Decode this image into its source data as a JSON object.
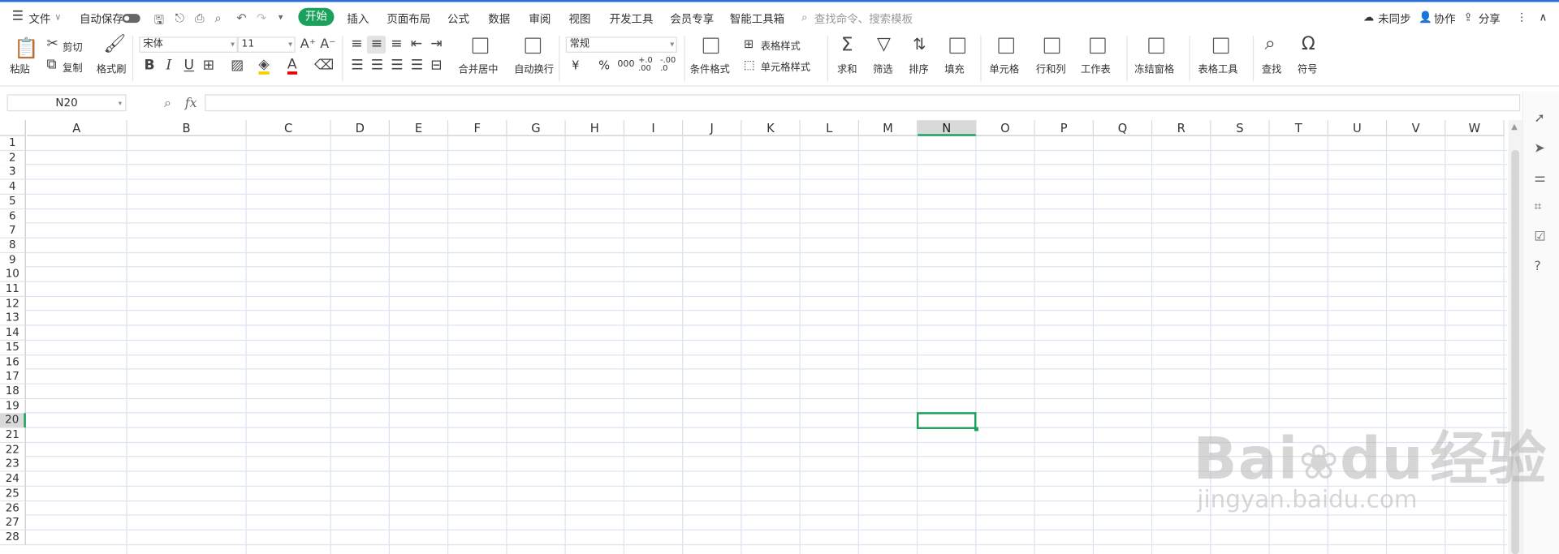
{
  "menu": {
    "file": "文件",
    "autosave": "自动保存",
    "tabs": [
      "开始",
      "插入",
      "页面布局",
      "公式",
      "数据",
      "审阅",
      "视图",
      "开发工具",
      "会员专享",
      "智能工具箱"
    ],
    "search_placeholder": "查找命令、搜索模板",
    "unsync": "未同步",
    "collab": "协作",
    "share": "分享"
  },
  "ribbon": {
    "paste": "粘贴",
    "cut": "剪切",
    "copy": "复制",
    "format_painter": "格式刷",
    "font": "宋体",
    "font_size": "11",
    "merge_center": "合并居中",
    "auto_wrap": "自动换行",
    "number_format": "常规",
    "currency": "¥",
    "percent": "%",
    "thousands": "000",
    "dec_inc": "+.0 .00",
    "dec_dec": "-.00 .0",
    "cond_format": "条件格式",
    "table_style": "表格样式",
    "cell_style": "单元格样式",
    "sum": "求和",
    "filter": "筛选",
    "sort": "排序",
    "fill": "填充",
    "cell": "单元格",
    "row_col": "行和列",
    "worksheet": "工作表",
    "freeze": "冻结窗格",
    "table_tools": "表格工具",
    "find": "查找",
    "symbol": "符号"
  },
  "formula_bar": {
    "name_box": "N20",
    "fx": "fx",
    "value": ""
  },
  "grid": {
    "columns": [
      "A",
      "B",
      "C",
      "D",
      "E",
      "F",
      "G",
      "H",
      "I",
      "J",
      "K",
      "L",
      "M",
      "N",
      "O",
      "P",
      "Q",
      "R",
      "S",
      "T",
      "U",
      "V",
      "W"
    ],
    "rows": [
      "1",
      "2",
      "3",
      "4",
      "5",
      "6",
      "7",
      "8",
      "9",
      "10",
      "11",
      "12",
      "13",
      "14",
      "15",
      "16",
      "17",
      "18",
      "19",
      "20",
      "21",
      "22",
      "23",
      "24",
      "25",
      "26",
      "27",
      "28"
    ],
    "selected_col": "N",
    "selected_row": "20"
  },
  "watermark": {
    "brand": "Bai",
    "brand2": "du",
    "jy": "经验",
    "url": "jingyan.baidu.com"
  },
  "colors": {
    "accent": "#1aa15c",
    "topline": "#2b6cd6"
  }
}
